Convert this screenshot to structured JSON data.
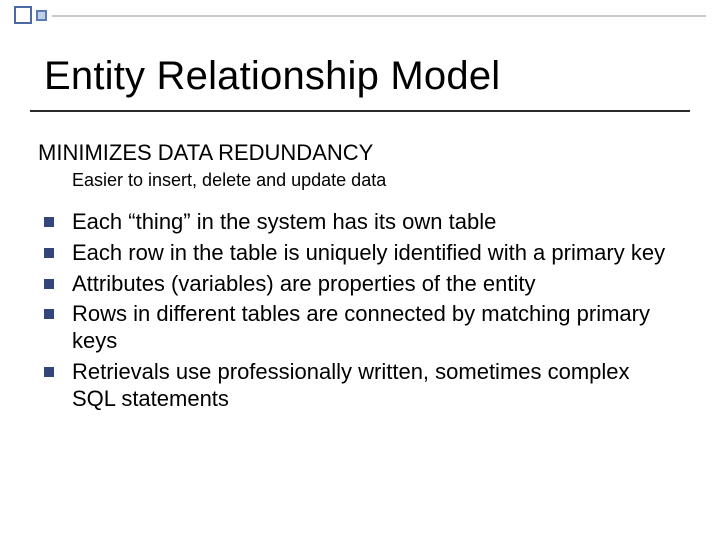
{
  "slide": {
    "title": "Entity Relationship Model",
    "subhead": "MINIMIZES DATA REDUNDANCY",
    "subnote": "Easier to insert, delete and update data",
    "points": [
      "Each “thing” in the system has its own table",
      "Each row in the table is uniquely identified with a primary key",
      "Attributes (variables) are properties of the entity",
      "Rows in different tables are connected by matching primary keys",
      "Retrievals use professionally written, sometimes complex SQL statements"
    ]
  }
}
